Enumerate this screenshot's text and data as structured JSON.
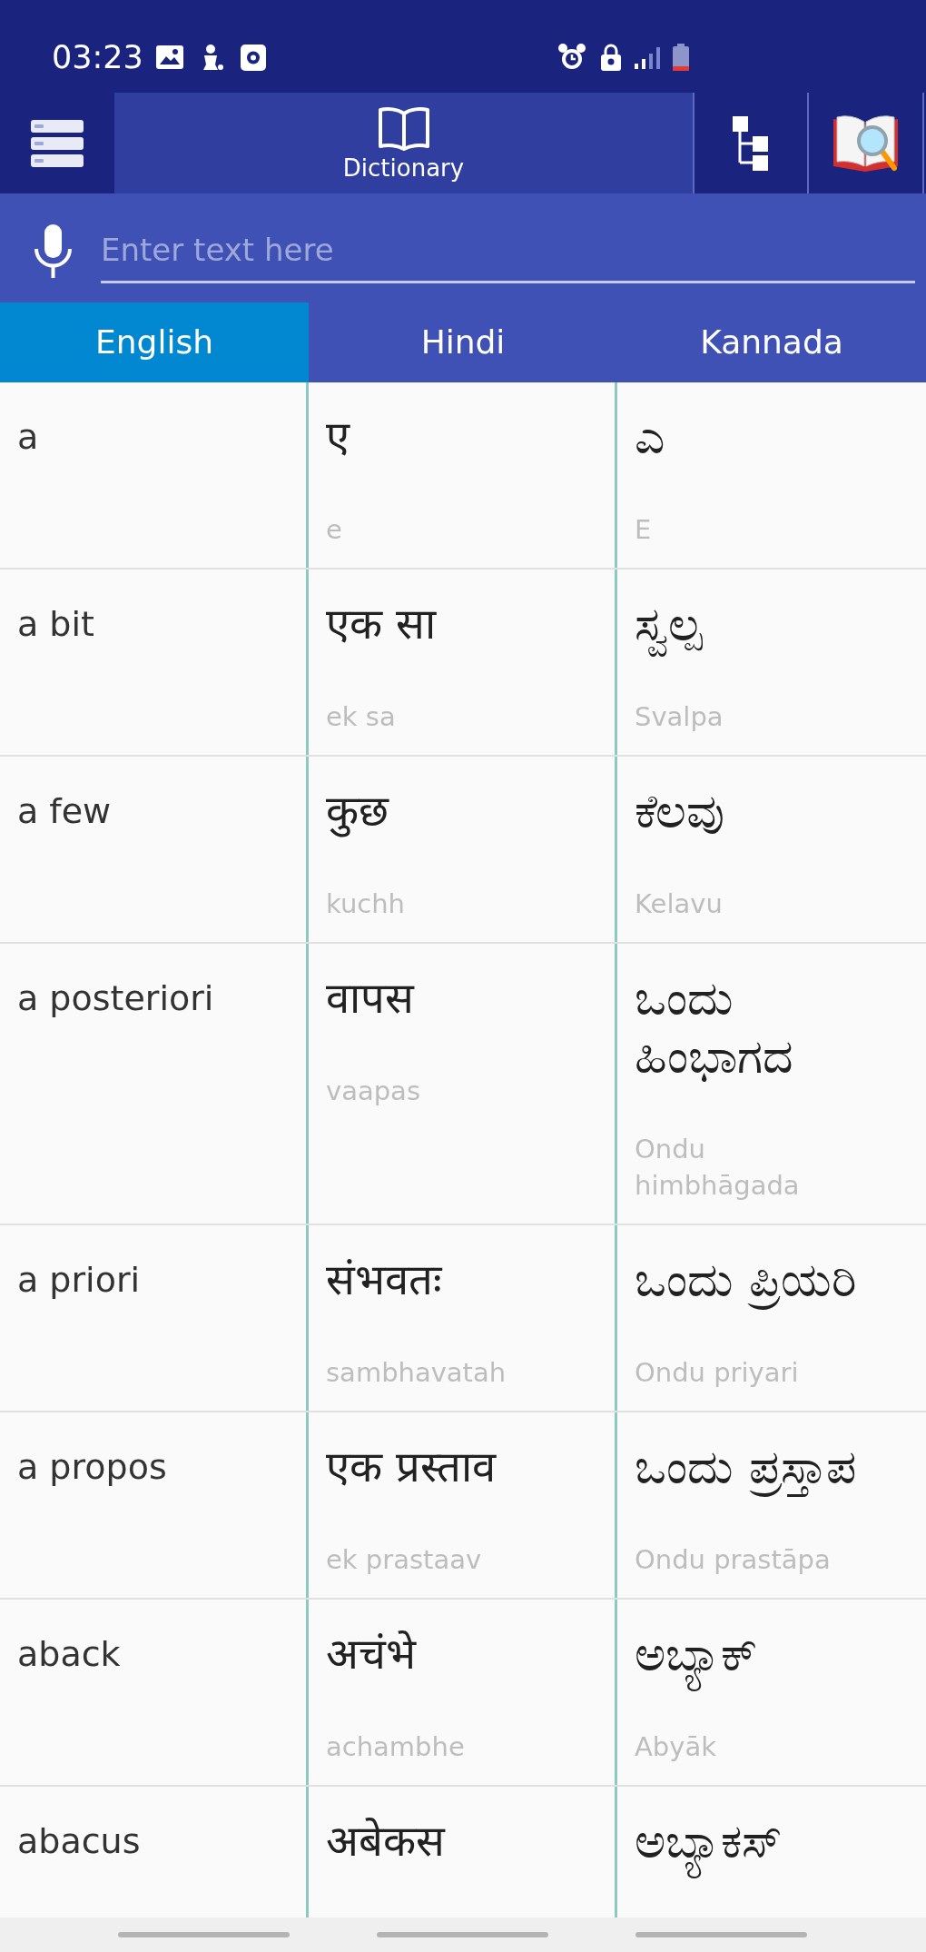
{
  "status_bar": {
    "time": "03:23"
  },
  "toolbar": {
    "tabs": [
      {
        "kind": "dictionary",
        "label": "Dictionary",
        "selected": true
      },
      {
        "kind": "hierarchy",
        "selected": false
      },
      {
        "kind": "book-search",
        "selected": false
      }
    ]
  },
  "search": {
    "placeholder": "Enter text here"
  },
  "language_tabs": [
    {
      "label": "English",
      "selected": true
    },
    {
      "label": "Hindi",
      "selected": false
    },
    {
      "label": "Kannada",
      "selected": false
    }
  ],
  "entries": [
    {
      "english": "a",
      "hindi": {
        "word": "ए",
        "transliteration": "e"
      },
      "kannada": {
        "word": "ಎ",
        "transliteration": "E"
      }
    },
    {
      "english": "a bit",
      "hindi": {
        "word": "एक सा",
        "transliteration": "ek sa"
      },
      "kannada": {
        "word": "ಸ್ವಲ್ಪ",
        "transliteration": "Svalpa"
      }
    },
    {
      "english": "a few",
      "hindi": {
        "word": "कुछ",
        "transliteration": "kuchh"
      },
      "kannada": {
        "word": "ಕೆಲವು",
        "transliteration": "Kelavu"
      }
    },
    {
      "english": "a posteriori",
      "hindi": {
        "word": "वापस",
        "transliteration": "vaapas"
      },
      "kannada": {
        "word": "ಒಂದು ಹಿಂಭಾಗದ",
        "transliteration": "Ondu himbhāgada"
      }
    },
    {
      "english": "a priori",
      "hindi": {
        "word": "संभवतः",
        "transliteration": "sambhavatah"
      },
      "kannada": {
        "word": "ಒಂದು ಪ್ರಿಯರಿ",
        "transliteration": "Ondu priyari"
      }
    },
    {
      "english": "a propos",
      "hindi": {
        "word": "एक प्रस्ताव",
        "transliteration": "ek prastaav"
      },
      "kannada": {
        "word": "ಒಂದು ಪ್ರಸ್ತಾಪ",
        "transliteration": "Ondu prastāpa"
      }
    },
    {
      "english": "aback",
      "hindi": {
        "word": "अचंभे",
        "transliteration": "achambhe"
      },
      "kannada": {
        "word": "ಅಬ್ಯಾಕ್",
        "transliteration": "Abyāk"
      }
    },
    {
      "english": "abacus",
      "hindi": {
        "word": "अबेकस"
      },
      "kannada": {
        "word": "ಅಬ್ಯಾಕಸ್"
      }
    }
  ]
}
